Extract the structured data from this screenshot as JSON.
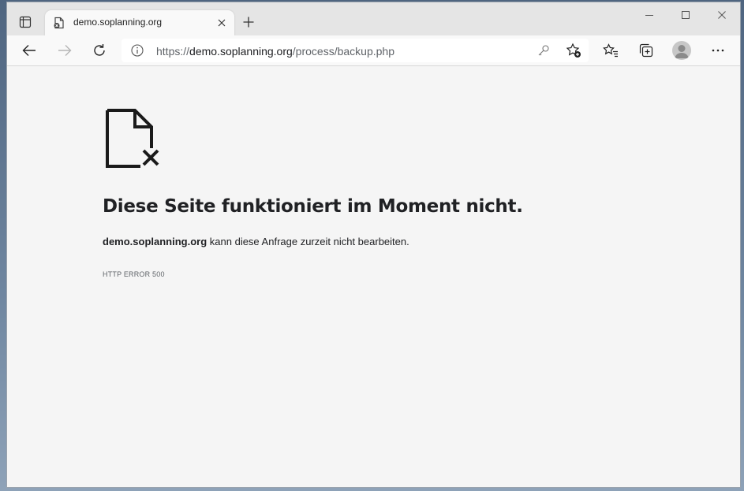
{
  "tab": {
    "title": "demo.soplanning.org",
    "favicon": "broken-page-icon"
  },
  "window_controls": {
    "minimize": "minimize-icon",
    "maximize": "maximize-icon",
    "close": "close-icon"
  },
  "toolbar": {
    "back": "back-arrow-icon",
    "forward": "forward-arrow-icon",
    "refresh": "refresh-icon",
    "url_prefix": "https://",
    "url_host": "demo.soplanning.org",
    "url_path": "/process/backup.php",
    "favorites": "favorites-icon",
    "collections": "collections-icon",
    "profile": "profile-avatar",
    "menu": "more-menu-icon"
  },
  "error": {
    "heading": "Diese Seite funktioniert im Moment nicht.",
    "host": "demo.soplanning.org",
    "message": " kann diese Anfrage zurzeit nicht bearbeiten.",
    "code": "HTTP ERROR 500"
  },
  "colors": {
    "content_bg": "#f5f5f5",
    "tabstrip_bg": "#e5e5e5",
    "text": "#202124",
    "muted": "#5f6368"
  }
}
